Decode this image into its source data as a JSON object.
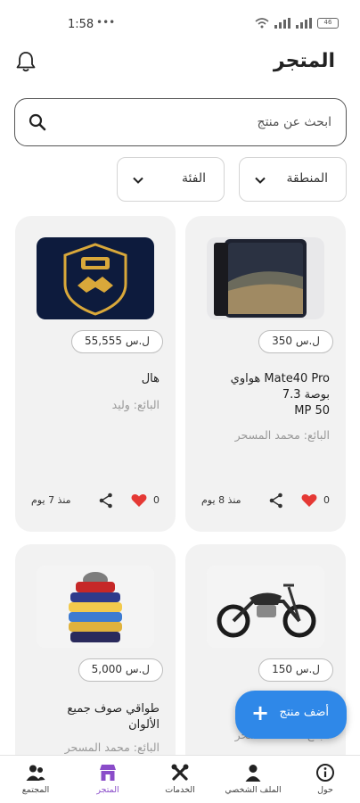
{
  "status_bar": {
    "time": "1:58",
    "extras": "•••",
    "battery": "46"
  },
  "header": {
    "title": "المتجر"
  },
  "search": {
    "placeholder": "ابحث عن منتج"
  },
  "filters": [
    {
      "label": "المنطقة"
    },
    {
      "label": "الفئة"
    }
  ],
  "products": [
    {
      "price": "ل.س 350",
      "name_line1": "Mate40 Pro هواوي",
      "name_line2": "بوصة 7.3",
      "name_line3": "50 MP",
      "seller": "البائع: محمد المسحر",
      "likes": "0",
      "since": "منذ 8 يوم",
      "image": "phone-image"
    },
    {
      "price": "ل.س 55,555",
      "name_line1": "هال",
      "seller": "البائع: وليد",
      "likes": "0",
      "since": "منذ 7 يوم",
      "image": "logo-image"
    },
    {
      "price": "ل.س 150",
      "name_line1": "",
      "seller": "البائع: محمد المسحر",
      "image": "motorcycle-image"
    },
    {
      "price": "ل.س 5,000",
      "name_line1": "طواقي صوف جميع",
      "name_line2": "الألوان",
      "seller": "البائع: محمد المسحر",
      "image": "hats-image"
    }
  ],
  "fab": {
    "label": "أضف منتج",
    "icon": "+"
  },
  "nav": [
    {
      "label": "حول",
      "icon": "info-icon"
    },
    {
      "label": "الملف الشخصي",
      "icon": "person-icon"
    },
    {
      "label": "الخدمات",
      "icon": "tools-icon"
    },
    {
      "label": "المتجر",
      "icon": "store-icon",
      "active": true
    },
    {
      "label": "المجتمع",
      "icon": "community-icon"
    }
  ],
  "colors": {
    "accent": "#2f88e8",
    "active_nav": "#8a4cc9",
    "heart": "#e53935"
  }
}
